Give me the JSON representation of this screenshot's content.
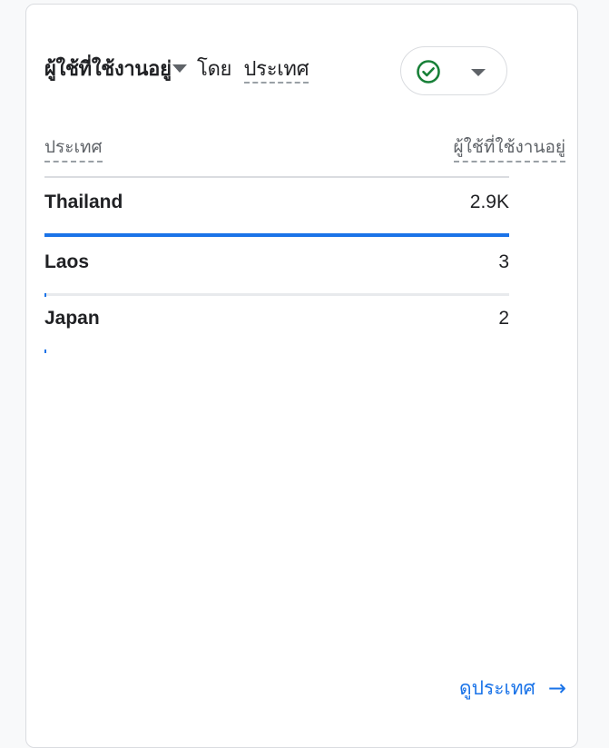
{
  "card": {
    "title_metric": "ผู้ใช้ที่ใช้งานอยู่",
    "title_by": "โดย",
    "title_dimension": "ประเทศ"
  },
  "compare_button": {
    "icon": "check-circle-icon",
    "accent": "#188038"
  },
  "table": {
    "column_left": "ประเทศ",
    "column_right": "ผู้ใช้ที่ใช้งานอยู่",
    "rows": [
      {
        "name": "Thailand",
        "value": "2.9K",
        "share": 1.0
      },
      {
        "name": "Laos",
        "value": "3",
        "share": 0.001
      },
      {
        "name": "Japan",
        "value": "2",
        "share": 0.0007
      }
    ],
    "bar_color": "#1a73e8"
  },
  "footer": {
    "link_label": "ดูประเทศ",
    "link_icon": "arrow-right-icon"
  }
}
